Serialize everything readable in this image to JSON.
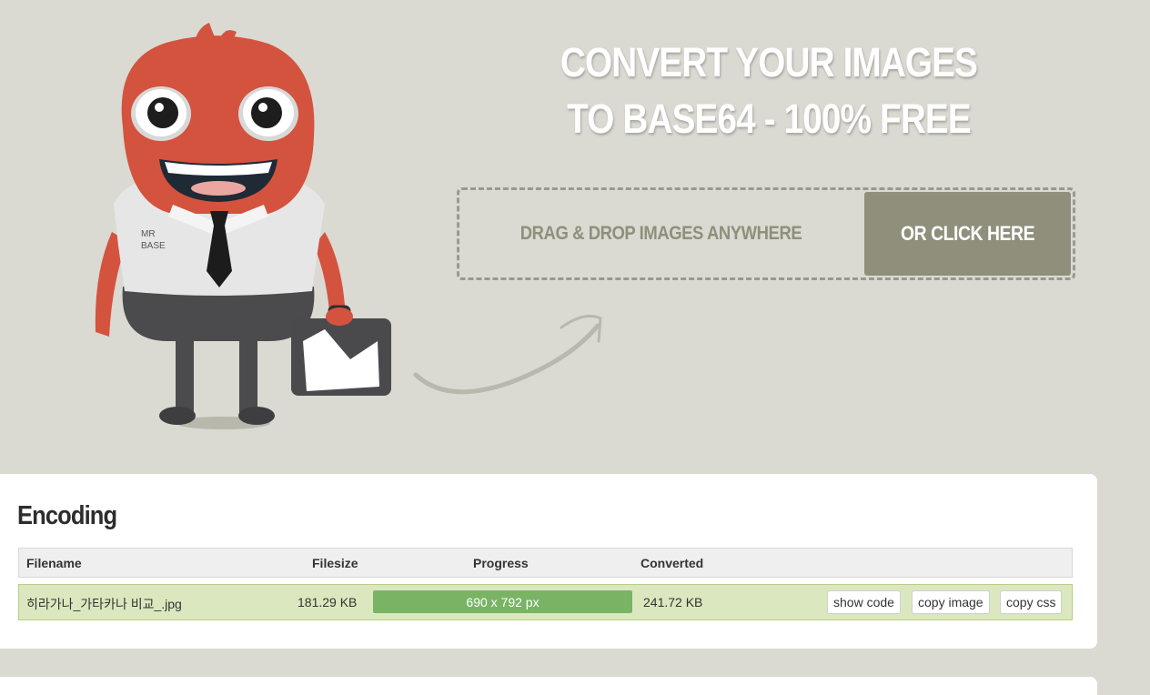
{
  "hero": {
    "headline_line1": "CONVERT YOUR IMAGES",
    "headline_line2": "TO BASE64 - 100% FREE",
    "mascot_shirt_text_line1": "MR",
    "mascot_shirt_text_line2": "BASE",
    "dropzone_text": "DRAG & DROP IMAGES ANYWHERE",
    "click_button_label": "OR CLICK HERE"
  },
  "encoding": {
    "title": "Encoding",
    "columns": {
      "filename": "Filename",
      "filesize": "Filesize",
      "progress": "Progress",
      "converted": "Converted"
    },
    "rows": [
      {
        "filename": "히라가나_가타카나 비교_.jpg",
        "filesize": "181.29 KB",
        "progress_label": "690 x 792 px",
        "progress_fraction": 1.0,
        "converted": "241.72 KB",
        "actions": {
          "show_code": "show code",
          "copy_image": "copy image",
          "copy_css": "copy css"
        }
      }
    ]
  },
  "colors": {
    "background": "#dad9d2",
    "accent": "#8f8f7c",
    "progress": "#79b465",
    "row_highlight": "#dbe8bf"
  }
}
